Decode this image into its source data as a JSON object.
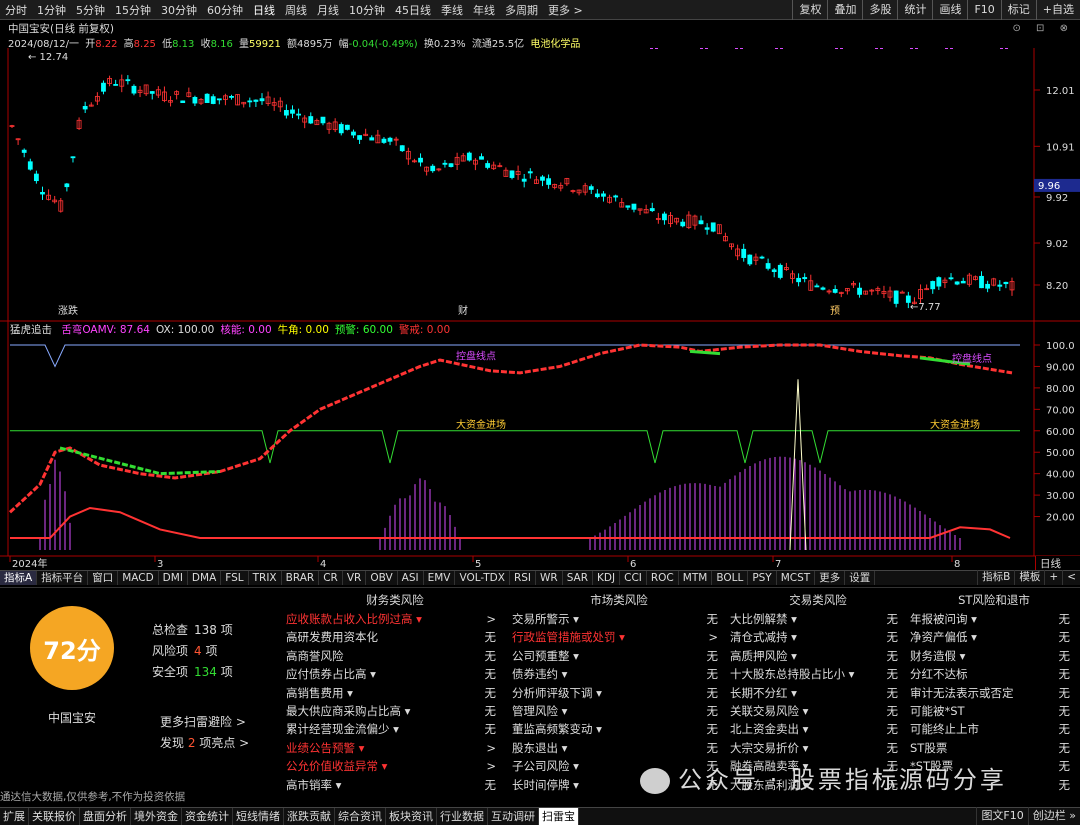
{
  "toolbar": {
    "periods": [
      "分时",
      "1分钟",
      "5分钟",
      "15分钟",
      "30分钟",
      "60分钟",
      "日线",
      "周线",
      "月线",
      "10分钟",
      "45日线",
      "季线",
      "年线",
      "多周期",
      "更多 >"
    ],
    "active_period": "日线",
    "right_buttons": [
      "复权",
      "叠加",
      "多股",
      "统计",
      "画线",
      "F10",
      "标记",
      "+自选"
    ]
  },
  "title": "中国宝安(日线 前复权)",
  "quote": {
    "date": "2024/08/12/一",
    "open_label": "开",
    "open": "8.22",
    "high_label": "高",
    "high": "8.25",
    "low_label": "低",
    "low": "8.13",
    "close_label": "收",
    "close": "8.16",
    "volume_label": "量",
    "volume": "59921",
    "amount_label": "额",
    "amount": "4895万",
    "change_label": "幅",
    "change": "-0.04(-0.49%)",
    "turnover_label": "换",
    "turnover": "0.23%",
    "float_label": "流通",
    "float_cap": "25.5亿",
    "sector": "电池化学品"
  },
  "price_axis": {
    "ticks": [
      "12.01",
      "10.91",
      "9.92",
      "9.02",
      "8.20"
    ],
    "current": "9.96"
  },
  "price_chart": {
    "max_label": "12.74",
    "min_label": "7.77"
  },
  "event_tags": [
    "涨跌",
    "财",
    "预"
  ],
  "indicator": {
    "name": "猛虎追击",
    "params": [
      {
        "label": "舌弯OAMV",
        "value": "87.64",
        "color": "#ff44ff"
      },
      {
        "label": "OX",
        "value": "100.00",
        "color": "#dddddd"
      },
      {
        "label": "核能",
        "value": "0.00",
        "color": "#ff44ff"
      },
      {
        "label": "牛角",
        "value": "0.00",
        "color": "#ffff00"
      },
      {
        "label": "预警",
        "value": "60.00",
        "color": "#33ff33"
      },
      {
        "label": "警戒",
        "value": "0.00",
        "color": "#ff3333"
      }
    ],
    "axis_ticks": [
      "100.0",
      "90.00",
      "80.00",
      "70.00",
      "60.00",
      "50.00",
      "40.00",
      "30.00",
      "20.00"
    ],
    "annotations": [
      "控盘线点",
      "大资金进场",
      "大资金进场",
      "控盘线点"
    ]
  },
  "time_axis": {
    "labels": [
      "2024年",
      "3",
      "4",
      "5",
      "6",
      "7",
      "8"
    ],
    "right_label": "日线"
  },
  "indicator_tabs": [
    "指标A",
    "指标平台",
    "窗口",
    "MACD",
    "DMI",
    "DMA",
    "FSL",
    "TRIX",
    "BRAR",
    "CR",
    "VR",
    "OBV",
    "ASI",
    "EMV",
    "VOL-TDX",
    "RSI",
    "WR",
    "SAR",
    "KDJ",
    "CCI",
    "ROC",
    "MTM",
    "BOLL",
    "PSY",
    "MCST",
    "更多",
    "设置"
  ],
  "indicator_tabs_right": [
    "指标B",
    "模板",
    "+",
    "<"
  ],
  "risk": {
    "score": "72分",
    "stock_name": "中国宝安",
    "total_label": "总检查",
    "total": "138",
    "total_unit": "项",
    "risk_label": "风险项",
    "risk_count": "4",
    "risk_unit": "项",
    "safe_label": "安全项",
    "safe_count": "134",
    "safe_unit": "项",
    "more_link": "更多扫雷避险 >",
    "highlight_prefix": "发现",
    "highlight_count": "2",
    "highlight_suffix": "项亮点 >"
  },
  "columns": [
    {
      "title": "财务类风险",
      "rows": [
        {
          "label": "应收账款占收入比例过高 ▾",
          "status": ">",
          "alert": true
        },
        {
          "label": "高研发费用资本化",
          "status": "无",
          "alert": false
        },
        {
          "label": "高商誉风险",
          "status": "无",
          "alert": false
        },
        {
          "label": "应付债券占比高 ▾",
          "status": "无",
          "alert": false
        },
        {
          "label": "高销售费用 ▾",
          "status": "无",
          "alert": false
        },
        {
          "label": "最大供应商采购占比高 ▾",
          "status": "无",
          "alert": false
        },
        {
          "label": "累计经营现金流偏少 ▾",
          "status": "无",
          "alert": false
        },
        {
          "label": "业绩公告预警 ▾",
          "status": ">",
          "alert": true
        },
        {
          "label": "公允价值收益异常 ▾",
          "status": ">",
          "alert": true
        },
        {
          "label": "高市销率 ▾",
          "status": "无",
          "alert": false
        }
      ]
    },
    {
      "title": "市场类风险",
      "rows": [
        {
          "label": "交易所警示 ▾",
          "status": "无",
          "alert": false
        },
        {
          "label": "行政监管措施或处罚 ▾",
          "status": ">",
          "alert": true
        },
        {
          "label": "公司预重整 ▾",
          "status": "无",
          "alert": false
        },
        {
          "label": "债券违约 ▾",
          "status": "无",
          "alert": false
        },
        {
          "label": "分析师评级下调 ▾",
          "status": "无",
          "alert": false
        },
        {
          "label": "管理风险 ▾",
          "status": "无",
          "alert": false
        },
        {
          "label": "董监高频繁变动 ▾",
          "status": "无",
          "alert": false
        },
        {
          "label": "股东退出 ▾",
          "status": "无",
          "alert": false
        },
        {
          "label": "子公司风险 ▾",
          "status": "无",
          "alert": false
        },
        {
          "label": "长时间停牌 ▾",
          "status": "无",
          "alert": false
        }
      ]
    },
    {
      "title": "交易类风险",
      "rows": [
        {
          "label": "大比例解禁 ▾",
          "status": "无",
          "alert": false
        },
        {
          "label": "清仓式减持 ▾",
          "status": "无",
          "alert": false
        },
        {
          "label": "高质押风险 ▾",
          "status": "无",
          "alert": false
        },
        {
          "label": "十大股东总持股占比小 ▾",
          "status": "无",
          "alert": false
        },
        {
          "label": "长期不分红 ▾",
          "status": "无",
          "alert": false
        },
        {
          "label": "关联交易风险 ▾",
          "status": "无",
          "alert": false
        },
        {
          "label": "北上资金卖出 ▾",
          "status": "无",
          "alert": false
        },
        {
          "label": "大宗交易折价 ▾",
          "status": "无",
          "alert": false
        },
        {
          "label": "融券高融卖率 ▾",
          "status": "无",
          "alert": false
        },
        {
          "label": "大股东高利润 ▾",
          "status": "无",
          "alert": false
        }
      ]
    },
    {
      "title": "ST风险和退市",
      "rows": [
        {
          "label": "年报被问询 ▾",
          "status": "无",
          "alert": false
        },
        {
          "label": "净资产偏低 ▾",
          "status": "无",
          "alert": false
        },
        {
          "label": "财务造假 ▾",
          "status": "无",
          "alert": false
        },
        {
          "label": "分红不达标",
          "status": "无",
          "alert": false
        },
        {
          "label": "审计无法表示或否定",
          "status": "无",
          "alert": false
        },
        {
          "label": "可能被*ST",
          "status": "无",
          "alert": false
        },
        {
          "label": "可能终止上市",
          "status": "无",
          "alert": false
        },
        {
          "label": "ST股票",
          "status": "无",
          "alert": false
        },
        {
          "label": "*ST股票",
          "status": "无",
          "alert": false
        },
        {
          "label": "",
          "status": "无",
          "alert": false
        }
      ]
    }
  ],
  "footnote": "通达信大数据,仅供参考,不作为投资依据",
  "watermark": "公众号 · 股票指标源码分享",
  "bottom_tabs": [
    "扩展",
    "关联报价",
    "盘面分析",
    "境外资金",
    "资金统计",
    "短线情绪",
    "涨跌贡献",
    "综合资讯",
    "板块资讯",
    "行业数据",
    "互动调研",
    "扫雷宝"
  ],
  "bottom_selected": "扫雷宝",
  "bottom_right": [
    "图文F10",
    "创边栏 »"
  ],
  "colors": {
    "up": "#ff3333",
    "down": "#00ffff",
    "purple": "#d94cff",
    "green": "#33dd33",
    "orange": "#f5a623"
  }
}
